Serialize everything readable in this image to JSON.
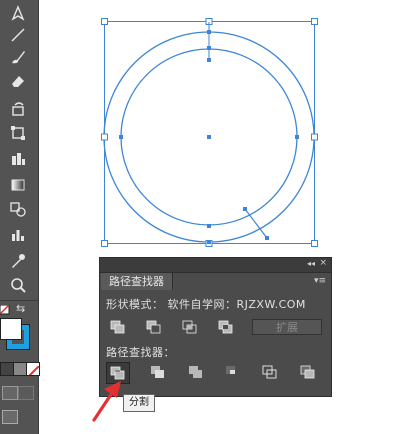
{
  "toolbar": {
    "tools": [
      "pen-tool-icon",
      "line-tool-icon",
      "paintbrush-tool-icon",
      "eraser-tool-icon",
      "rotate-tool-icon",
      "free-transform-tool-icon",
      "shape-builder-tool-icon",
      "gradient-tool-icon",
      "blend-tool-icon",
      "graph-tool-icon",
      "eyedropper-tool-icon",
      "zoom-tool-icon"
    ],
    "fill_color": "#ffffff",
    "stroke_color": "#1ca0e0"
  },
  "canvas": {
    "stroke_color": "#3d86d6",
    "anchor_color": "#3d86d6"
  },
  "panel": {
    "collapse_glyph": "◂◂",
    "close_glyph": "×",
    "menu_glyph": "▾≡",
    "title": "路径查找器",
    "shape_modes_label": "形状模式：  软件自学网：RJZXW.COM",
    "expand_label": "扩展",
    "pathfinders_label": "路径查找器：",
    "shape_mode_buttons": [
      "unite-icon",
      "minus-front-icon",
      "intersect-icon",
      "exclude-icon"
    ],
    "pathfinder_buttons": [
      "divide-icon",
      "trim-icon",
      "merge-icon",
      "crop-icon",
      "outline-icon",
      "minus-back-icon"
    ]
  },
  "tooltip": {
    "text": "分割"
  },
  "annotation": {
    "arrow_color": "#e53030"
  }
}
